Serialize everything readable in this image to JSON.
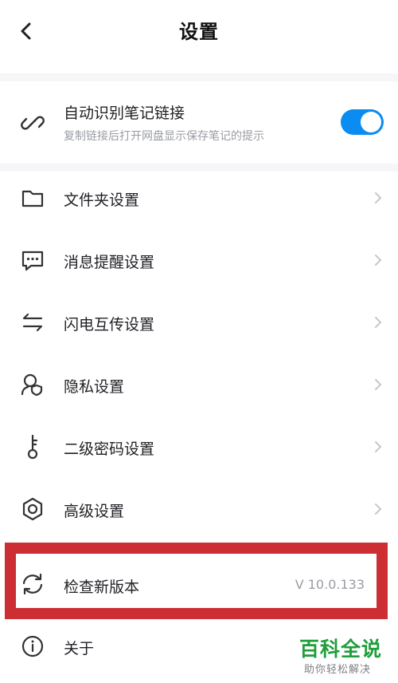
{
  "header": {
    "title": "设置"
  },
  "auto_link": {
    "label": "自动识别笔记链接",
    "description": "复制链接后打开网盘显示保存笔记的提示",
    "enabled": true
  },
  "menu": {
    "folder": "文件夹设置",
    "message": "消息提醒设置",
    "flash": "闪电互传设置",
    "privacy": "隐私设置",
    "password": "二级密码设置",
    "advanced": "高级设置",
    "check_update": "检查新版本",
    "about": "关于"
  },
  "version": "V 10.0.133",
  "watermark": {
    "title": "百科全说",
    "subtitle": "助你轻松解决"
  },
  "colors": {
    "toggle": "#0a8cf0",
    "highlight": "#cc2e33",
    "watermark": "#1f9e3a"
  }
}
